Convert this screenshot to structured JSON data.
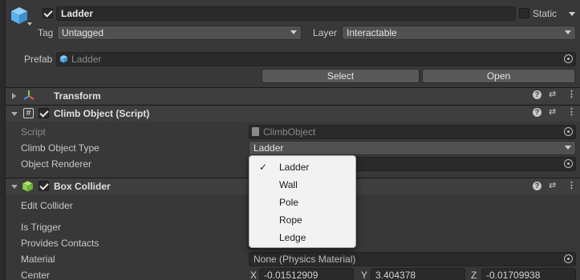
{
  "header": {
    "name": "Ladder",
    "static_label": "Static",
    "tag_label": "Tag",
    "tag_value": "Untagged",
    "layer_label": "Layer",
    "layer_value": "Interactable",
    "prefab_label": "Prefab",
    "prefab_value": "Ladder",
    "select_label": "Select",
    "open_label": "Open"
  },
  "components": {
    "transform": {
      "title": "Transform"
    },
    "climb": {
      "title": "Climb Object (Script)",
      "script_label": "Script",
      "script_value": "ClimbObject",
      "type_label": "Climb Object Type",
      "type_value": "Ladder",
      "renderer_label": "Object Renderer"
    },
    "box": {
      "title": "Box Collider",
      "edit_label": "Edit Collider",
      "trigger_label": "Is Trigger",
      "contacts_label": "Provides Contacts",
      "material_label": "Material",
      "material_value": "None (Physics Material)",
      "center_label": "Center",
      "center": {
        "x_label": "X",
        "x": "-0.01512909",
        "y_label": "Y",
        "y": "3.404378",
        "z_label": "Z",
        "z": "-0.01709938"
      }
    }
  },
  "popup": {
    "selected": "Ladder",
    "options": [
      "Ladder",
      "Wall",
      "Pole",
      "Rope",
      "Ledge"
    ]
  },
  "colors": {
    "background": "#383838",
    "field": "#2a2a2a",
    "popup_bg": "#f2f2f2",
    "cube_icon": "#5ab1ec",
    "collider_icon": "#8fd14f"
  }
}
